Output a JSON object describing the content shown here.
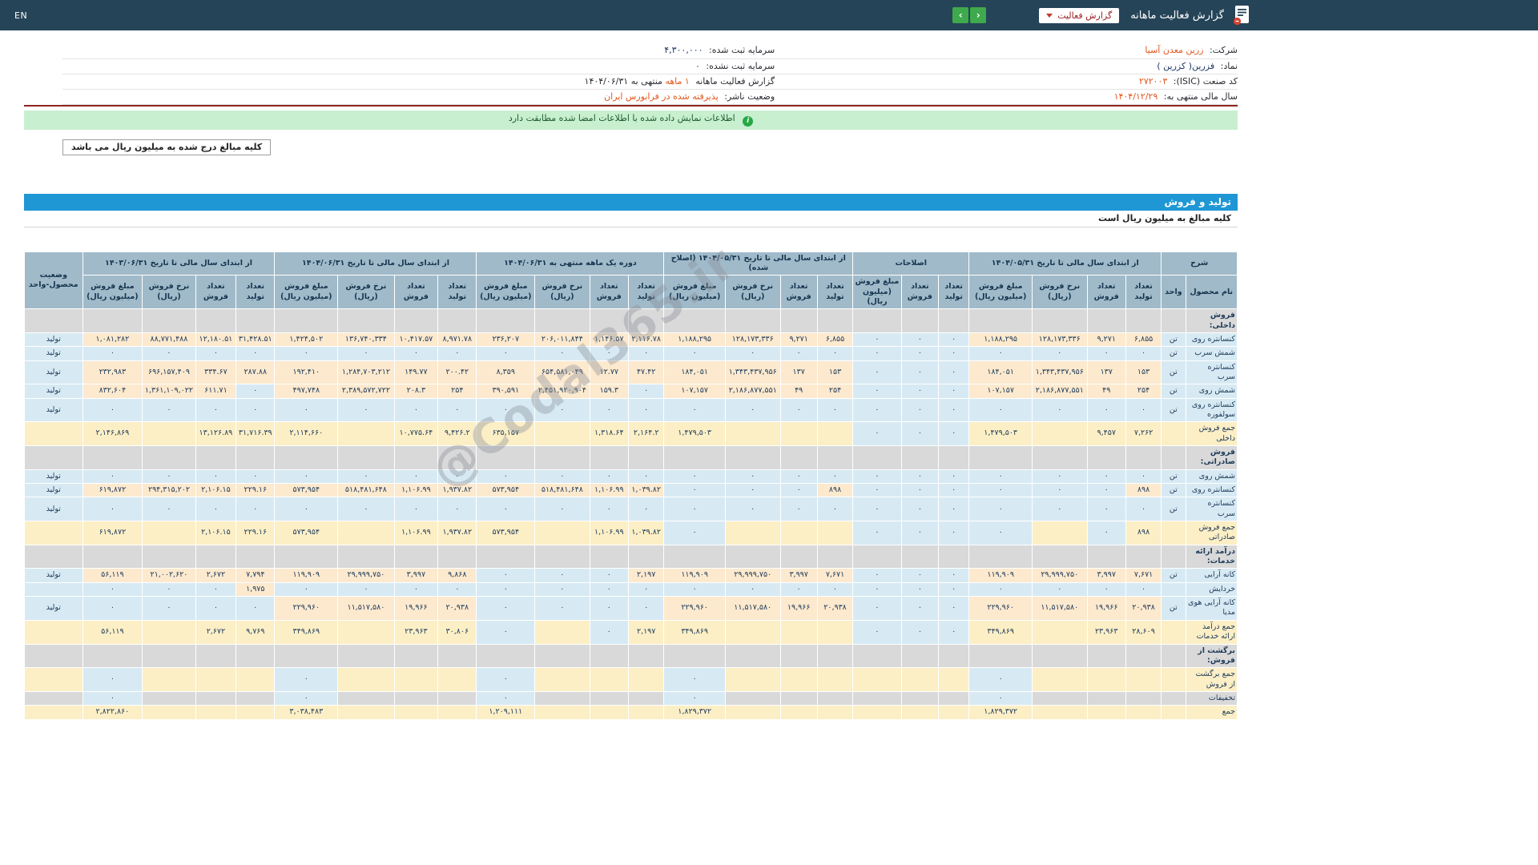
{
  "topbar": {
    "en_label": "EN",
    "title": "گزارش فعالیت ماهانه",
    "dropdown_label": "گزارش فعالیت",
    "arrow_right": "›",
    "arrow_left": "‹"
  },
  "colors": {
    "topbar_bg": "#264458",
    "accent_blue": "#1e97d4",
    "link_orange": "#e2571f",
    "banner_green": "#c8efd0",
    "divider_red": "#8e2420",
    "cell_blue": "#d7eaf4",
    "cell_cream": "#fce9ce",
    "cell_yellow": "#fcefc6",
    "cell_gray": "#d9d9d9",
    "arrow_green": "#3fa94d"
  },
  "info": {
    "rows": [
      {
        "rlabel": "شرکت:",
        "rvalue": "زرین معدن آسیا",
        "llabel": "سرمایه ثبت شده:",
        "lvalue": "۴,۳۰۰,۰۰۰"
      },
      {
        "rlabel": "نماد:",
        "rvalue": "فزرین( کزرین )",
        "llabel": "سرمایه ثبت نشده:",
        "lvalue": "۰"
      },
      {
        "rlabel": "کد صنعت (ISIC):",
        "rvalue": "۲۷۲۰۰۳",
        "llabel": "گزارش فعالیت ماهانه",
        "lvalue": "۱ ماهه",
        "lsuffix": "منتهی به ۱۴۰۴/۰۶/۳۱"
      },
      {
        "rlabel": "سال مالی منتهی به:",
        "rvalue": "۱۴۰۴/۱۲/۲۹",
        "llabel": "وضعیت ناشر:",
        "lvalue": "پذیرفته شده در فرابورس ایران"
      }
    ]
  },
  "messages": {
    "signature_match": "اطلاعات نمایش داده شده با اطلاعات امضا شده مطابقت دارد",
    "amounts_note": "کلیه مبالغ درج شده به میلیون ریال می باشد"
  },
  "production": {
    "title": "تولید و فروش",
    "subtitle": "کلیه مبالغ به میلیون ریال است"
  },
  "watermark": "@Codal365.ir",
  "table": {
    "groups": [
      {
        "label": "شرح",
        "subs": [
          "نام محصول",
          "واحد"
        ]
      },
      {
        "label": "از ابتدای سال مالی تا تاریخ ۱۴۰۴/۰۵/۳۱",
        "subs": [
          "تعداد تولید",
          "تعداد فروش",
          "نرخ فروش (ریال)",
          "مبلغ فروش (میلیون ریال)"
        ]
      },
      {
        "label": "اصلاحات",
        "subs": [
          "تعداد تولید",
          "تعداد فروش",
          "مبلغ فروش (میلیون ریال)"
        ]
      },
      {
        "label": "از ابتدای سال مالی تا تاریخ ۱۴۰۴/۰۵/۳۱ (اصلاح شده)",
        "subs": [
          "تعداد تولید",
          "تعداد فروش",
          "نرخ فروش (ریال)",
          "مبلغ فروش (میلیون ریال)"
        ]
      },
      {
        "label": "دوره یک ماهه منتهی به ۱۴۰۴/۰۶/۳۱",
        "subs": [
          "تعداد تولید",
          "تعداد فروش",
          "نرخ فروش (ریال)",
          "مبلغ فروش (میلیون ریال)"
        ]
      },
      {
        "label": "از ابتدای سال مالی تا تاریخ ۱۴۰۴/۰۶/۳۱",
        "subs": [
          "تعداد تولید",
          "تعداد فروش",
          "نرخ فروش (ریال)",
          "مبلغ فروش (میلیون ریال)"
        ]
      },
      {
        "label": "از ابتدای سال مالی تا تاریخ ۱۴۰۳/۰۶/۳۱",
        "subs": [
          "تعداد تولید",
          "تعداد فروش",
          "نرخ فروش (ریال)",
          "مبلغ فروش (میلیون ریال)"
        ]
      },
      {
        "label": "وضعیت محصول-واحد",
        "subs": []
      }
    ],
    "rows": [
      {
        "type": "section",
        "name": "فروش داخلی:"
      },
      {
        "type": "product",
        "name": "کنسانتره روی",
        "unit": "تن",
        "status": "تولید",
        "cells": [
          "۶,۸۵۵",
          "۹,۲۷۱",
          "۱۲۸,۱۷۳,۳۳۶",
          "۱,۱۸۸,۲۹۵",
          "۰",
          "۰",
          "۰",
          "۶,۸۵۵",
          "۹,۲۷۱",
          "۱۲۸,۱۷۳,۳۳۶",
          "۱,۱۸۸,۲۹۵",
          "۲,۱۱۶.۷۸",
          "۱,۱۴۶.۵۷",
          "۲۰۶,۰۱۱,۸۴۴",
          "۲۳۶,۲۰۷",
          "۸,۹۷۱.۷۸",
          "۱۰,۴۱۷.۵۷",
          "۱۳۶,۷۴۰,۳۳۴",
          "۱,۴۲۴,۵۰۲",
          "۳۱,۴۲۸.۵۱",
          "۱۲,۱۸۰.۵۱",
          "۸۸,۷۷۱,۴۸۸",
          "۱,۰۸۱,۲۸۲"
        ]
      },
      {
        "type": "product",
        "name": "شمش سرب",
        "unit": "تن",
        "status": "تولید",
        "cells": [
          "۰",
          "۰",
          "۰",
          "۰",
          "۰",
          "۰",
          "۰",
          "۰",
          "۰",
          "۰",
          "۰",
          "۰",
          "۰",
          "۰",
          "۰",
          "۰",
          "۰",
          "۰",
          "۰",
          "۰",
          "۰",
          "۰",
          "۰"
        ]
      },
      {
        "type": "product",
        "name": "کنسانتره سرب",
        "unit": "تن",
        "status": "تولید",
        "cells": [
          "۱۵۳",
          "۱۳۷",
          "۱,۳۴۳,۴۳۷,۹۵۶",
          "۱۸۴,۰۵۱",
          "۰",
          "۰",
          "۰",
          "۱۵۳",
          "۱۳۷",
          "۱,۳۴۳,۴۳۷,۹۵۶",
          "۱۸۴,۰۵۱",
          "۴۷.۴۲",
          "۱۲.۷۷",
          "۶۵۴,۵۸۱,۰۴۹",
          "۸,۳۵۹",
          "۲۰۰.۴۲",
          "۱۴۹.۷۷",
          "۱,۲۸۴,۷۰۳,۲۱۲",
          "۱۹۲,۴۱۰",
          "۲۸۷.۸۸",
          "۳۳۴.۶۷",
          "۶۹۶,۱۵۷,۴۰۹",
          "۲۳۲,۹۸۳"
        ]
      },
      {
        "type": "product",
        "name": "شمش روی",
        "unit": "تن",
        "status": "تولید",
        "cells": [
          "۲۵۴",
          "۴۹",
          "۲,۱۸۶,۸۷۷,۵۵۱",
          "۱۰۷,۱۵۷",
          "۰",
          "۰",
          "۰",
          "۲۵۴",
          "۴۹",
          "۲,۱۸۶,۸۷۷,۵۵۱",
          "۱۰۷,۱۵۷",
          "۰",
          "۱۵۹.۳",
          "۲,۴۵۱,۹۲۰,۹۰۴",
          "۳۹۰,۵۹۱",
          "۲۵۴",
          "۲۰۸.۳",
          "۲,۳۸۹,۵۷۲,۷۲۲",
          "۴۹۷,۷۴۸",
          "۰",
          "۶۱۱.۷۱",
          "۱,۳۶۱,۱۰۹,۰۲۲",
          "۸۳۲,۶۰۴"
        ]
      },
      {
        "type": "product",
        "name": "کنسانتره روی سولفوره",
        "unit": "تن",
        "status": "تولید",
        "cells": [
          "۰",
          "۰",
          "۰",
          "۰",
          "۰",
          "۰",
          "۰",
          "۰",
          "۰",
          "۰",
          "۰",
          "۰",
          "۰",
          "۰",
          "۰",
          "۰",
          "۰",
          "۰",
          "۰",
          "۰",
          "۰",
          "۰",
          "۰"
        ]
      },
      {
        "type": "total",
        "name": "جمع فروش داخلی",
        "cells": [
          "۷,۲۶۲",
          "۹,۴۵۷",
          "",
          "۱,۴۷۹,۵۰۳",
          "۰",
          "۰",
          "۰",
          "",
          "",
          "",
          "۱,۴۷۹,۵۰۳",
          "۲,۱۶۴.۲",
          "۱,۳۱۸.۶۴",
          "",
          "۶۳۵,۱۵۷",
          "۹,۴۲۶.۲",
          "۱۰,۷۷۵.۶۴",
          "",
          "۲,۱۱۴,۶۶۰",
          "۳۱,۷۱۶.۳۹",
          "۱۳,۱۲۶.۸۹",
          "",
          "۲,۱۴۶,۸۶۹"
        ]
      },
      {
        "type": "section",
        "name": "فروش صادراتی:"
      },
      {
        "type": "product",
        "name": "شمش روی",
        "unit": "تن",
        "status": "تولید",
        "cells": [
          "۰",
          "۰",
          "۰",
          "۰",
          "۰",
          "۰",
          "۰",
          "۰",
          "۰",
          "۰",
          "۰",
          "۰",
          "۰",
          "۰",
          "۰",
          "۰",
          "۰",
          "۰",
          "۰",
          "۰",
          "۰",
          "۰",
          "۰"
        ]
      },
      {
        "type": "product",
        "name": "کنسانتره روی",
        "unit": "تن",
        "status": "تولید",
        "cells": [
          "۸۹۸",
          "۰",
          "۰",
          "۰",
          "۰",
          "۰",
          "۰",
          "۸۹۸",
          "۰",
          "۰",
          "۰",
          "۱,۰۳۹.۸۲",
          "۱,۱۰۶.۹۹",
          "۵۱۸,۴۸۱,۶۴۸",
          "۵۷۳,۹۵۴",
          "۱,۹۳۷.۸۲",
          "۱,۱۰۶.۹۹",
          "۵۱۸,۴۸۱,۶۴۸",
          "۵۷۳,۹۵۴",
          "۲۲۹.۱۶",
          "۲,۱۰۶.۱۵",
          "۲۹۴,۳۱۵,۲۰۲",
          "۶۱۹,۸۷۲"
        ]
      },
      {
        "type": "product",
        "name": "کنسانتره سرب",
        "unit": "تن",
        "status": "تولید",
        "cells": [
          "۰",
          "۰",
          "۰",
          "۰",
          "۰",
          "۰",
          "۰",
          "۰",
          "۰",
          "۰",
          "۰",
          "۰",
          "۰",
          "۰",
          "۰",
          "۰",
          "۰",
          "۰",
          "۰",
          "۰",
          "۰",
          "۰",
          "۰"
        ]
      },
      {
        "type": "total",
        "name": "جمع فروش صادراتی",
        "cells": [
          "۸۹۸",
          "۰",
          "",
          "۰",
          "۰",
          "۰",
          "۰",
          "",
          "",
          "",
          "۰",
          "۱,۰۳۹.۸۲",
          "۱,۱۰۶.۹۹",
          "",
          "۵۷۳,۹۵۴",
          "۱,۹۳۷.۸۲",
          "۱,۱۰۶.۹۹",
          "",
          "۵۷۳,۹۵۴",
          "۲۲۹.۱۶",
          "۲,۱۰۶.۱۵",
          "",
          "۶۱۹,۸۷۲"
        ]
      },
      {
        "type": "section",
        "name": "درآمد ارائه خدمات:"
      },
      {
        "type": "product",
        "name": "کانه آرایی",
        "unit": "تن",
        "status": "تولید",
        "cells": [
          "۷,۶۷۱",
          "۳,۹۹۷",
          "۲۹,۹۹۹,۷۵۰",
          "۱۱۹,۹۰۹",
          "۰",
          "۰",
          "۰",
          "۷,۶۷۱",
          "۳,۹۹۷",
          "۲۹,۹۹۹,۷۵۰",
          "۱۱۹,۹۰۹",
          "۲,۱۹۷",
          "۰",
          "۰",
          "۰",
          "۹,۸۶۸",
          "۳,۹۹۷",
          "۲۹,۹۹۹,۷۵۰",
          "۱۱۹,۹۰۹",
          "۷,۷۹۴",
          "۲,۶۷۲",
          "۲۱,۰۰۲,۶۲۰",
          "۵۶,۱۱۹"
        ]
      },
      {
        "type": "product",
        "name": "خردایش",
        "unit": "",
        "status": "",
        "cells": [
          "۰",
          "۰",
          "۰",
          "۰",
          "۰",
          "۰",
          "۰",
          "۰",
          "۰",
          "۰",
          "۰",
          "۰",
          "۰",
          "۰",
          "۰",
          "۰",
          "۰",
          "۰",
          "۰",
          "۱,۹۷۵",
          "۰",
          "۰",
          "۰"
        ]
      },
      {
        "type": "product",
        "name": "کانه آرایی هوی مدیا",
        "unit": "تن",
        "status": "تولید",
        "cells": [
          "۲۰,۹۳۸",
          "۱۹,۹۶۶",
          "۱۱,۵۱۷,۵۸۰",
          "۲۲۹,۹۶۰",
          "۰",
          "۰",
          "۰",
          "۲۰,۹۳۸",
          "۱۹,۹۶۶",
          "۱۱,۵۱۷,۵۸۰",
          "۲۲۹,۹۶۰",
          "۰",
          "۰",
          "۰",
          "۰",
          "۲۰,۹۳۸",
          "۱۹,۹۶۶",
          "۱۱,۵۱۷,۵۸۰",
          "۲۲۹,۹۶۰",
          "۰",
          "۰",
          "۰",
          "۰"
        ]
      },
      {
        "type": "total",
        "name": "جمع درآمد ارائه خدمات",
        "cells": [
          "۲۸,۶۰۹",
          "۲۳,۹۶۳",
          "",
          "۳۴۹,۸۶۹",
          "۰",
          "۰",
          "۰",
          "",
          "",
          "",
          "۳۴۹,۸۶۹",
          "۲,۱۹۷",
          "۰",
          "",
          "۰",
          "۳۰,۸۰۶",
          "۲۳,۹۶۳",
          "",
          "۳۴۹,۸۶۹",
          "۹,۷۶۹",
          "۲,۶۷۲",
          "",
          "۵۶,۱۱۹"
        ]
      },
      {
        "type": "section",
        "name": "برگشت از فروش:"
      },
      {
        "type": "total",
        "name": "جمع برگشت از فروش",
        "cells": [
          "",
          "",
          "",
          "۰",
          "",
          "",
          "",
          "",
          "",
          "",
          "۰",
          "",
          "",
          "",
          "۰",
          "",
          "",
          "",
          "۰",
          "",
          "",
          "",
          "۰"
        ]
      },
      {
        "type": "discount",
        "name": "تخفیفات",
        "cells": [
          "",
          "",
          "",
          "۰",
          "",
          "",
          "",
          "",
          "",
          "",
          "۰",
          "",
          "",
          "",
          "۰",
          "",
          "",
          "",
          "۰",
          "",
          "",
          "",
          "۰"
        ]
      },
      {
        "type": "total",
        "name": "جمع",
        "cells": [
          "",
          "",
          "",
          "۱,۸۲۹,۳۷۲",
          "",
          "",
          "",
          "",
          "",
          "",
          "۱,۸۲۹,۳۷۲",
          "",
          "",
          "",
          "۱,۲۰۹,۱۱۱",
          "",
          "",
          "",
          "۳,۰۳۸,۴۸۳",
          "",
          "",
          "",
          "۲,۸۲۲,۸۶۰"
        ]
      }
    ]
  }
}
